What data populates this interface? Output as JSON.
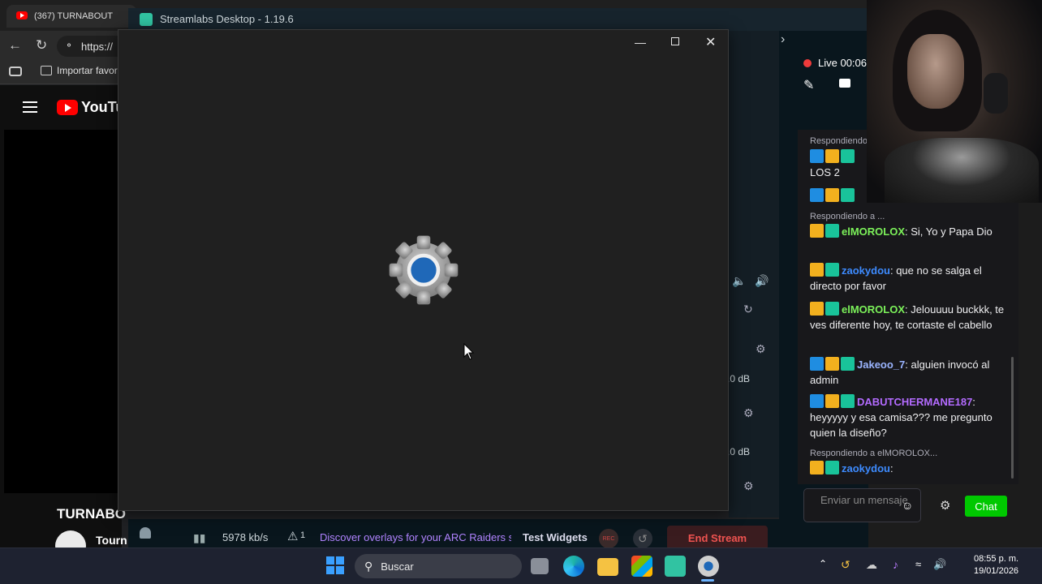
{
  "browser": {
    "tab_title": "(367) TURNABOUT",
    "url": "https://",
    "bookmark": "Importar favor",
    "youtube_logo": "YouTube",
    "channel_title": "TURNABO",
    "channel_name": "Tourn"
  },
  "streamlabs": {
    "window_title": "Streamlabs Desktop - 1.19.6",
    "bitrate": "5978 kb/s",
    "alert_count": "1",
    "discover_text": "Discover overlays for your ARC Raiders s",
    "test_widgets": "Test Widgets",
    "rec_label": "REC",
    "end_stream": "End Stream",
    "mixer_db_1": ".0 dB",
    "mixer_db_2": ".0 dB",
    "live_label": "Live 00:06"
  },
  "chat": {
    "reply_1": "Respondiendo a ...",
    "msg_1_text": "LOS 2",
    "reply_2": "Respondiendo a ...",
    "msg_3_name": "elMOROLOX",
    "msg_3_text": ": Si, Yo y Papa Dio",
    "msg_4_name": "zaokydou",
    "msg_4_text": ": que no se salga el directo por favor",
    "msg_5_name": "elMOROLOX",
    "msg_5_text": ": Jelouuuu buckkk, te ves diferente hoy, te cortaste el cabello",
    "msg_6_name": "Jakeoo_7",
    "msg_6_text": ": alguien invocó al admin",
    "msg_7_name": "DABUTCHERMANE187",
    "msg_7_text": ": heyyyyy y esa camisa??? me pregunto quien la diseño?",
    "reply_3": "Respondiendo a elMOROLOX...",
    "msg_8_name": "zaokydou",
    "msg_8_text": ":",
    "input_placeholder": "Enviar un mensaje",
    "chat_button": "Chat"
  },
  "taskbar": {
    "search_label": "Buscar",
    "time": "08:55 p. m.",
    "date": "19/01/2026"
  }
}
